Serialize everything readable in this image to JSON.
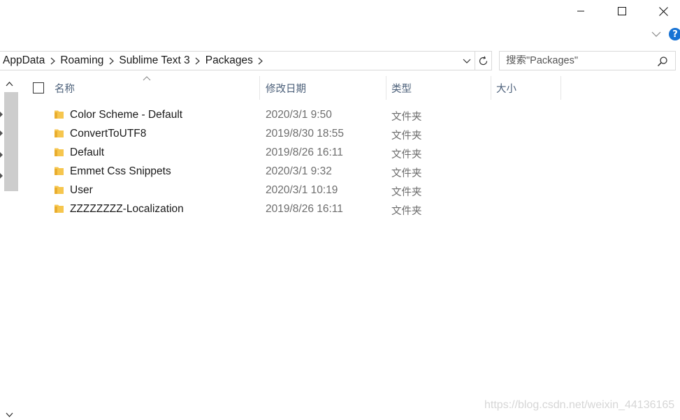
{
  "window": {
    "minimize_icon": "minimize-icon",
    "maximize_icon": "maximize-icon",
    "close_icon": "close-icon",
    "help_label": "?"
  },
  "breadcrumbs": [
    "AppData",
    "Roaming",
    "Sublime Text 3",
    "Packages"
  ],
  "search": {
    "placeholder": "搜索\"Packages\""
  },
  "columns": {
    "name": "名称",
    "date": "修改日期",
    "type": "类型",
    "size": "大小"
  },
  "files": [
    {
      "name": "Color Scheme - Default",
      "date": "2020/3/1 9:50",
      "type": "文件夹"
    },
    {
      "name": "ConvertToUTF8",
      "date": "2019/8/30 18:55",
      "type": "文件夹"
    },
    {
      "name": "Default",
      "date": "2019/8/26 16:11",
      "type": "文件夹"
    },
    {
      "name": "Emmet Css Snippets",
      "date": "2020/3/1 9:32",
      "type": "文件夹"
    },
    {
      "name": "User",
      "date": "2020/3/1 10:19",
      "type": "文件夹"
    },
    {
      "name": "ZZZZZZZZ-Localization",
      "date": "2019/8/26 16:11",
      "type": "文件夹"
    }
  ],
  "watermark": "https://blog.csdn.net/weixin_44136165",
  "colors": {
    "folder": "#f6c64e",
    "help_badge": "#1672d4",
    "header_text": "#4c607a"
  }
}
